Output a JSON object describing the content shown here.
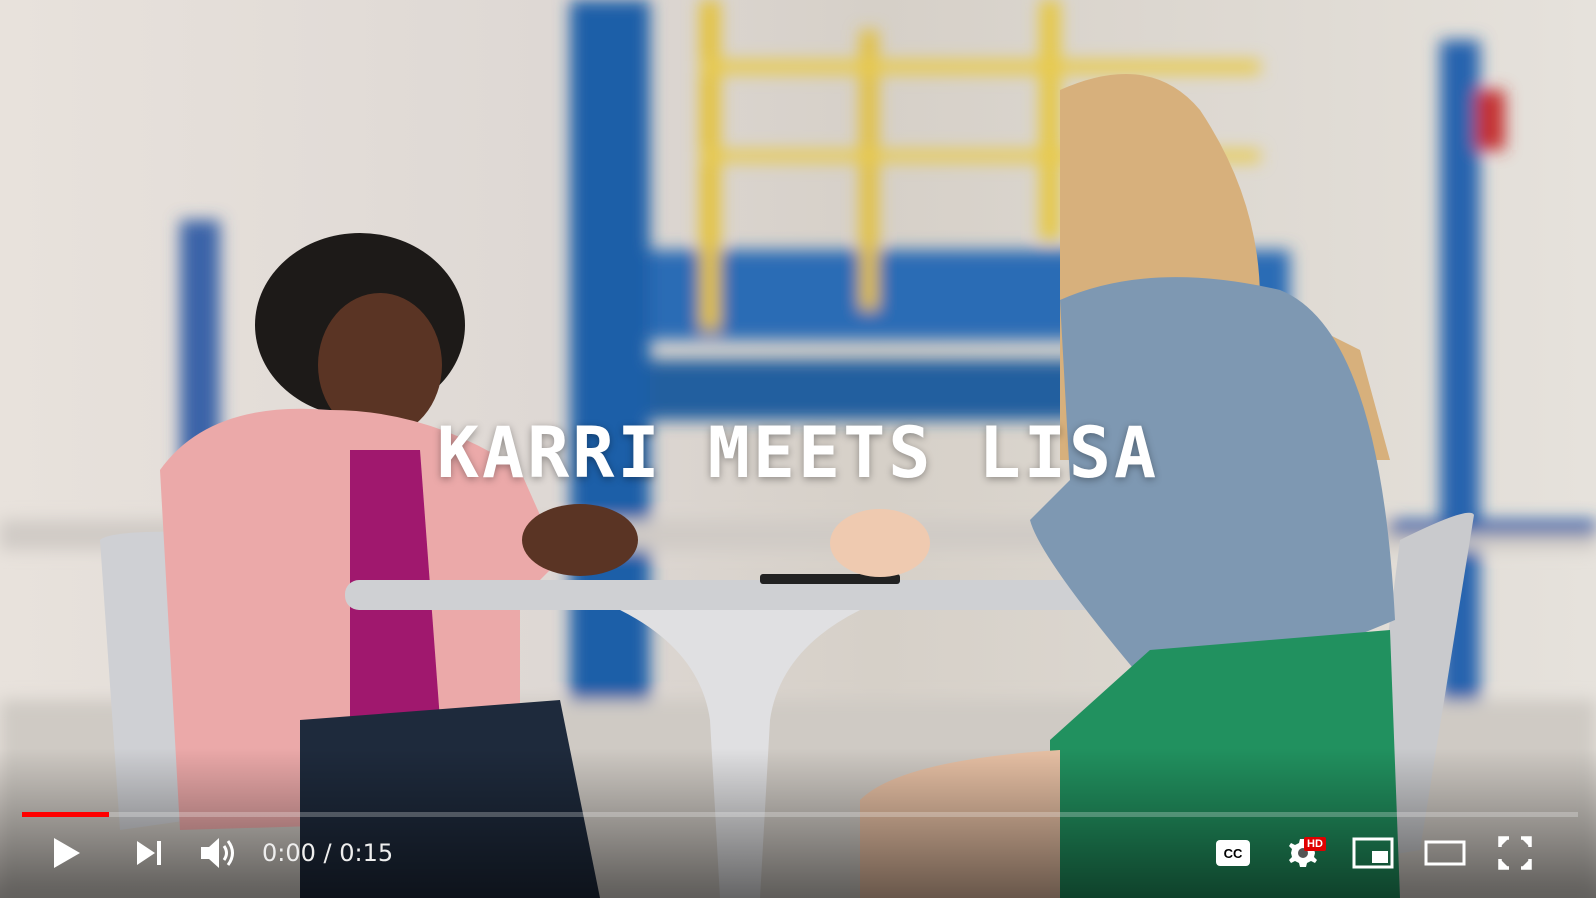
{
  "video": {
    "overlay_title": "KARRI MEETS LISA",
    "progress_played": 0.056,
    "progress_loaded": 0.056
  },
  "controls": {
    "current_time": "0:00",
    "separator": " / ",
    "duration": "0:15",
    "hd_badge": "HD",
    "icons": [
      "play-icon",
      "next-icon",
      "volume-icon",
      "captions-icon",
      "settings-icon",
      "miniplayer-icon",
      "theater-mode-icon",
      "fullscreen-icon"
    ]
  },
  "colors": {
    "progress_played": "#ff0000",
    "hd_badge": "#e00000"
  }
}
